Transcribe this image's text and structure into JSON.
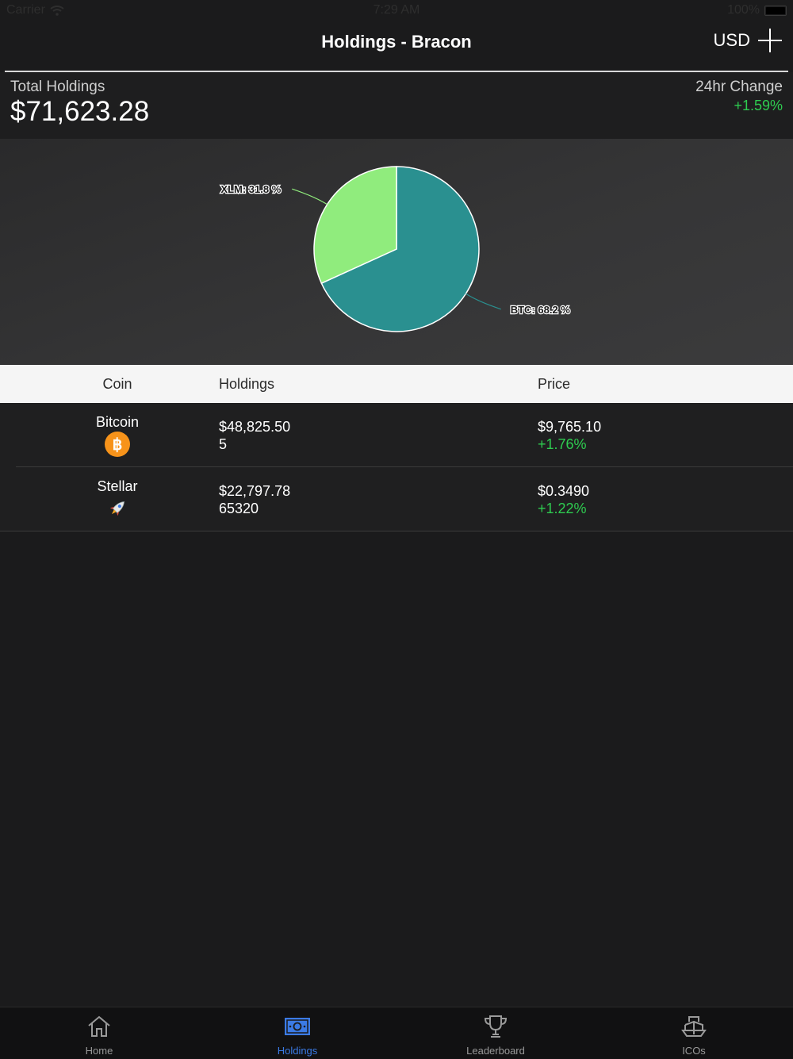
{
  "status_bar": {
    "carrier": "Carrier",
    "time": "7:29 AM",
    "battery": "100%"
  },
  "nav": {
    "title": "Holdings - Bracon",
    "currency": "USD"
  },
  "summary": {
    "total_label": "Total Holdings",
    "total_value": "$71,623.28",
    "change_label": "24hr Change",
    "change_value": "+1.59%"
  },
  "chart_data": {
    "type": "pie",
    "title": "",
    "slices": [
      {
        "name": "BTC",
        "label": "BTC: 68.2 %",
        "value": 68.2,
        "color": "#2a9090"
      },
      {
        "name": "XLM",
        "label": "XLM: 31.8 %",
        "value": 31.8,
        "color": "#90ec7d"
      }
    ]
  },
  "table": {
    "headers": [
      "Coin",
      "Holdings",
      "Price"
    ],
    "rows": [
      {
        "coin": "Bitcoin",
        "icon": "bitcoin-icon",
        "holdings_value": "$48,825.50",
        "holdings_amount": "5",
        "price": "$9,765.10",
        "price_change": "+1.76%"
      },
      {
        "coin": "Stellar",
        "icon": "stellar-rocket-icon",
        "holdings_value": "$22,797.78",
        "holdings_amount": "65320",
        "price": "$0.3490",
        "price_change": "+1.22%"
      }
    ]
  },
  "tabs": [
    {
      "label": "Home",
      "icon": "home-icon",
      "active": false
    },
    {
      "label": "Holdings",
      "icon": "money-icon",
      "active": true
    },
    {
      "label": "Leaderboard",
      "icon": "trophy-icon",
      "active": false
    },
    {
      "label": "ICOs",
      "icon": "ship-icon",
      "active": false
    }
  ],
  "colors": {
    "positive": "#2ecc50",
    "accent": "#3b7be6",
    "background": "#1b1b1c"
  }
}
